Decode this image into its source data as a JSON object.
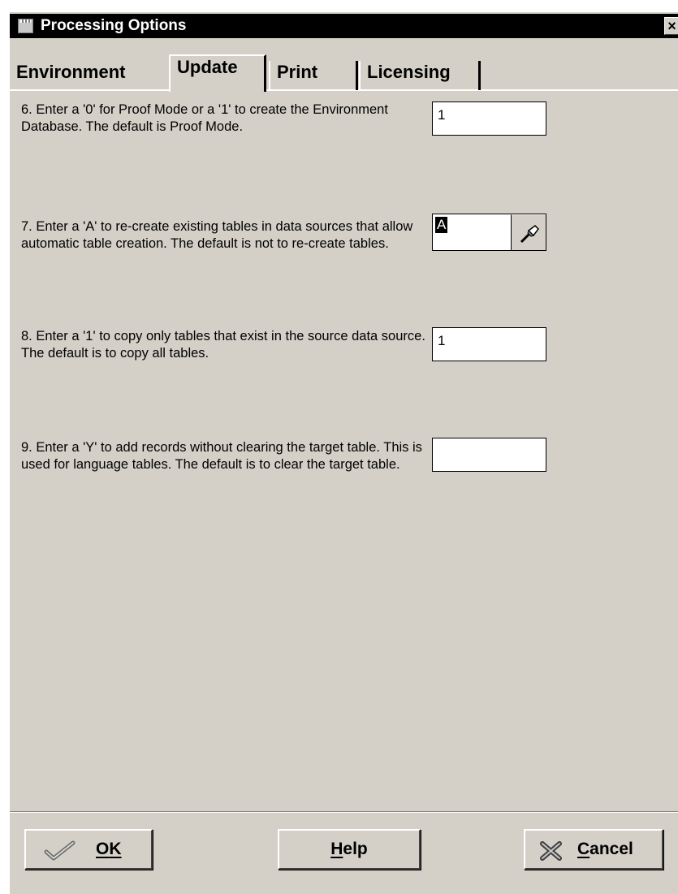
{
  "window": {
    "title": "Processing Options",
    "close_label": "×"
  },
  "tabs": [
    {
      "label": "Environment",
      "selected": false
    },
    {
      "label": "Update",
      "selected": true
    },
    {
      "label": "Print",
      "selected": false
    },
    {
      "label": "Licensing",
      "selected": false
    }
  ],
  "options": [
    {
      "text": "6. Enter a '0' for Proof Mode or a '1' to create the Environment Database.  The default is Proof Mode.",
      "value": "1"
    },
    {
      "text": "7. Enter a 'A' to re-create existing tables in data sources that allow automatic table creation. The default is not to re-create tables.",
      "value": "A"
    },
    {
      "text": "8. Enter a '1' to copy only tables that exist in the source data source.  The default is to copy all tables.",
      "value": "1"
    },
    {
      "text": "9. Enter a 'Y' to add records without clearing the target table.  This is used for language tables.  The default is to clear the target table.",
      "value": ""
    }
  ],
  "buttons": {
    "ok": {
      "first": "O",
      "rest": "K"
    },
    "help": {
      "first": "H",
      "rest": "elp"
    },
    "cancel": {
      "first": "C",
      "rest": "ancel"
    }
  }
}
